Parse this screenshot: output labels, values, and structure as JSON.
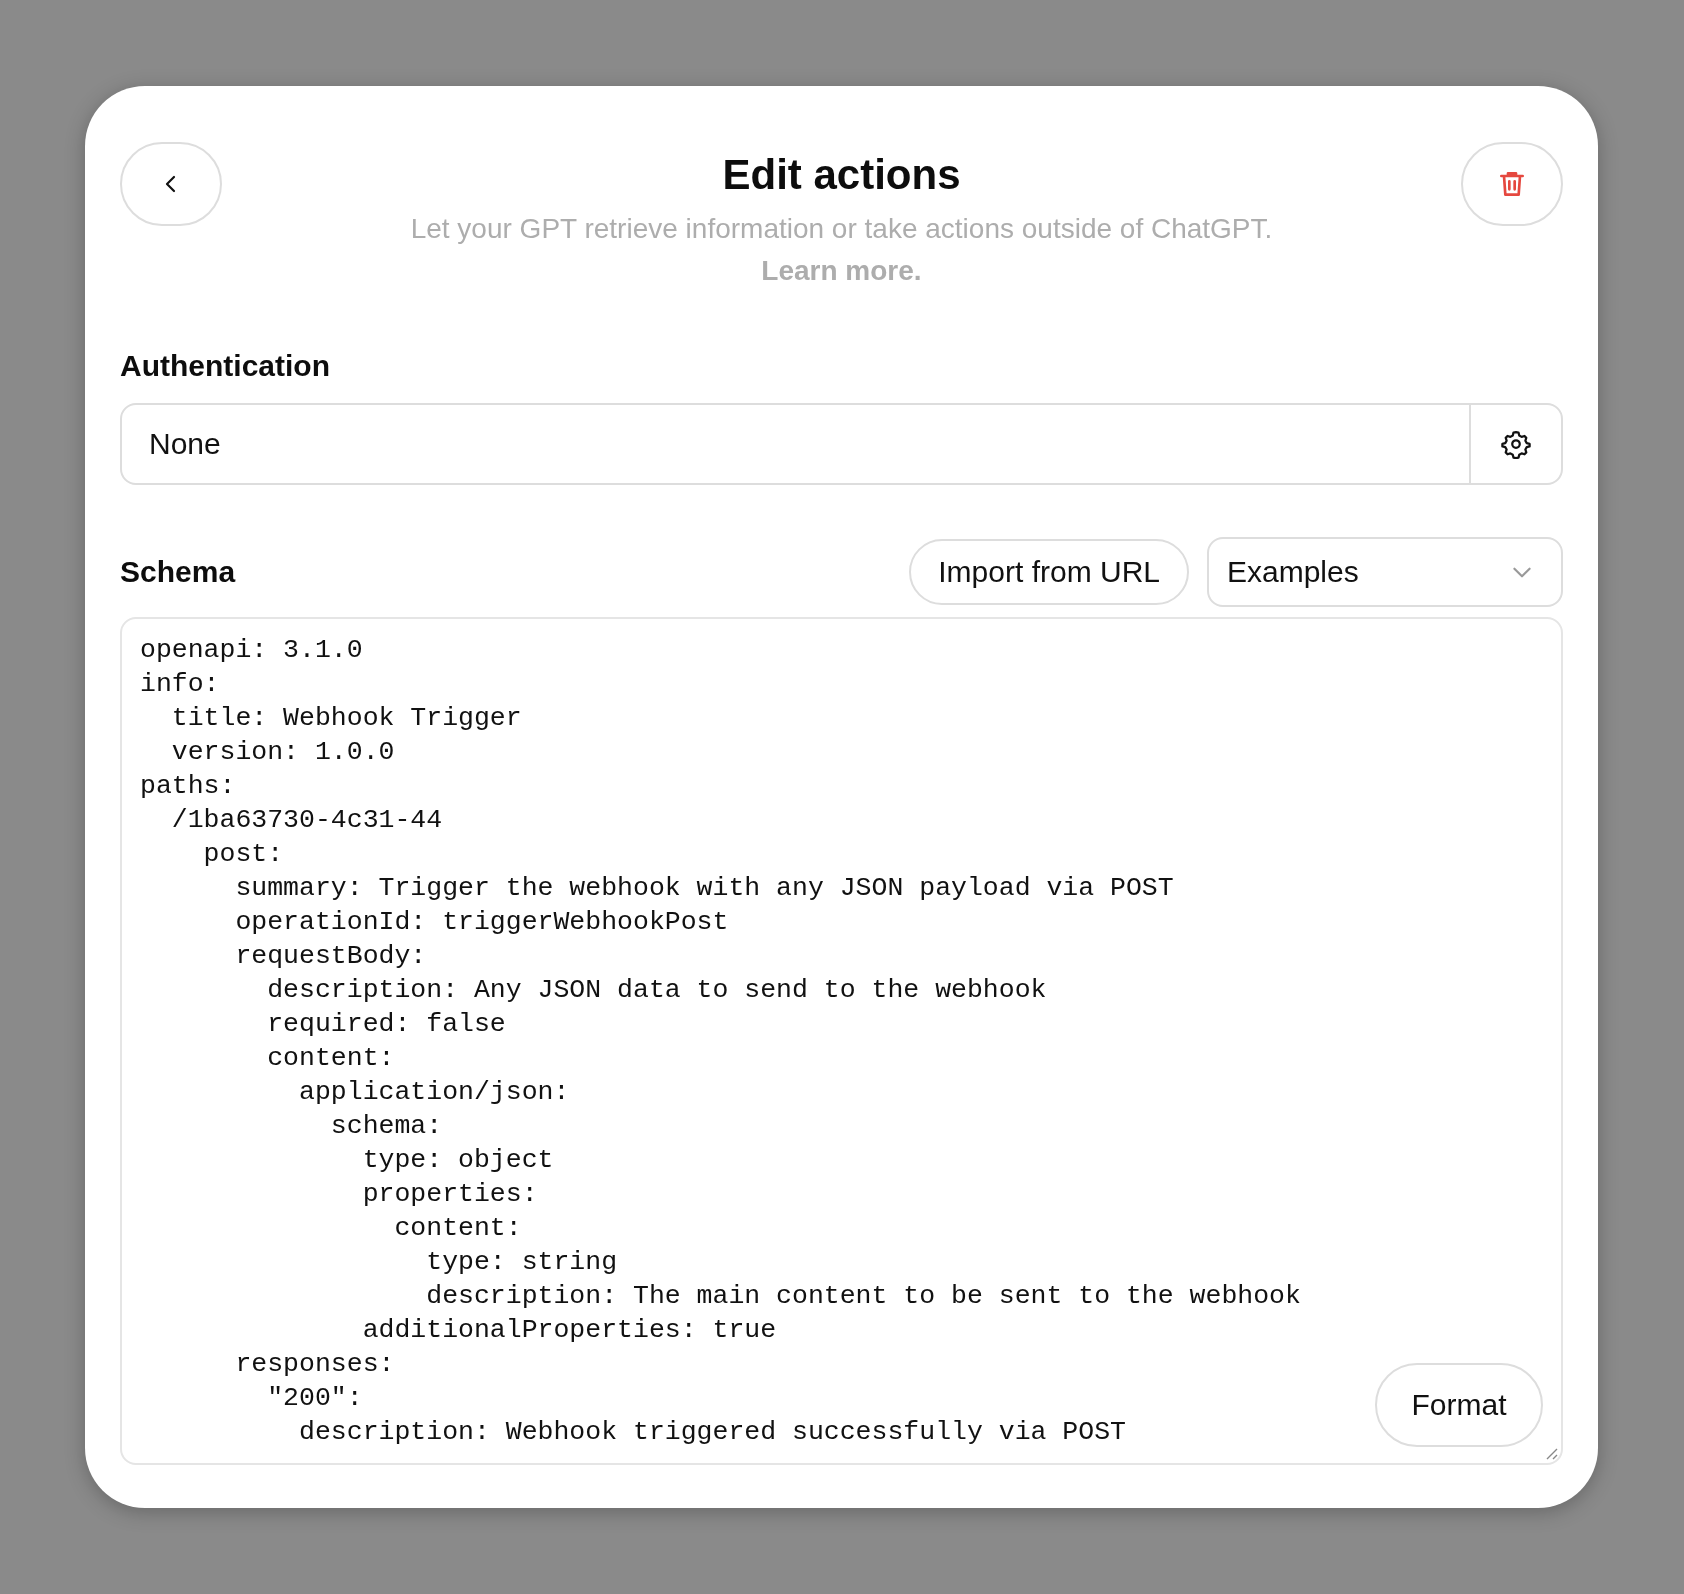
{
  "header": {
    "title": "Edit actions",
    "subtitle": "Let your GPT retrieve information or take actions outside of ChatGPT.",
    "link": "Learn more."
  },
  "authentication": {
    "label": "Authentication",
    "value": "None"
  },
  "schema": {
    "label": "Schema",
    "import_button": "Import from URL",
    "examples": "Examples",
    "code_lines": [
      "openapi: 3.1.0",
      "info:",
      "  title: Webhook Trigger",
      "  version: 1.0.0",
      "paths:",
      "  /1ba63730-4c31-44",
      "    post:",
      "      summary: Trigger the webhook with any JSON payload via POST",
      "      operationId: triggerWebhookPost",
      "      requestBody:",
      "        description: Any JSON data to send to the webhook",
      "        required: false",
      "        content:",
      "          application/json:",
      "            schema:",
      "              type: object",
      "              properties:",
      "                content:",
      "                  type: string",
      "                  description: The main content to be sent to the webhook",
      "              additionalProperties: true",
      "      responses:",
      "        \"200\":",
      "          description: Webhook triggered successfully via POST"
    ],
    "format_button": "Format"
  }
}
